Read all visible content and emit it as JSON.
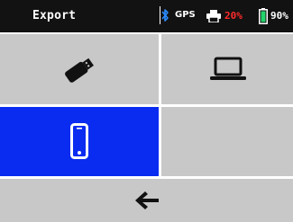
{
  "status": {
    "title": "Export",
    "gps_label": "GPS",
    "paper_level": "20%",
    "battery_level": "90%",
    "icons": {
      "bluetooth": "bluetooth-icon",
      "printer": "printer-icon",
      "battery": "battery-icon"
    },
    "colors": {
      "bar_bg": "#121212",
      "bluetooth": "#2a8cff",
      "paper_warning": "#ff2a2a",
      "battery": "#22d46a"
    }
  },
  "menu": {
    "tiles": [
      {
        "id": "usb",
        "icon": "usb-stick-icon",
        "selected": false
      },
      {
        "id": "laptop",
        "icon": "laptop-icon",
        "selected": false
      },
      {
        "id": "phone",
        "icon": "smartphone-icon",
        "selected": true
      },
      {
        "id": "empty",
        "icon": "",
        "selected": false
      }
    ],
    "back": {
      "icon": "arrow-left-icon"
    },
    "colors": {
      "tile_bg": "#c8c8c8",
      "selected_bg": "#0a2cf0",
      "grid_lines": "#ffffff"
    }
  }
}
